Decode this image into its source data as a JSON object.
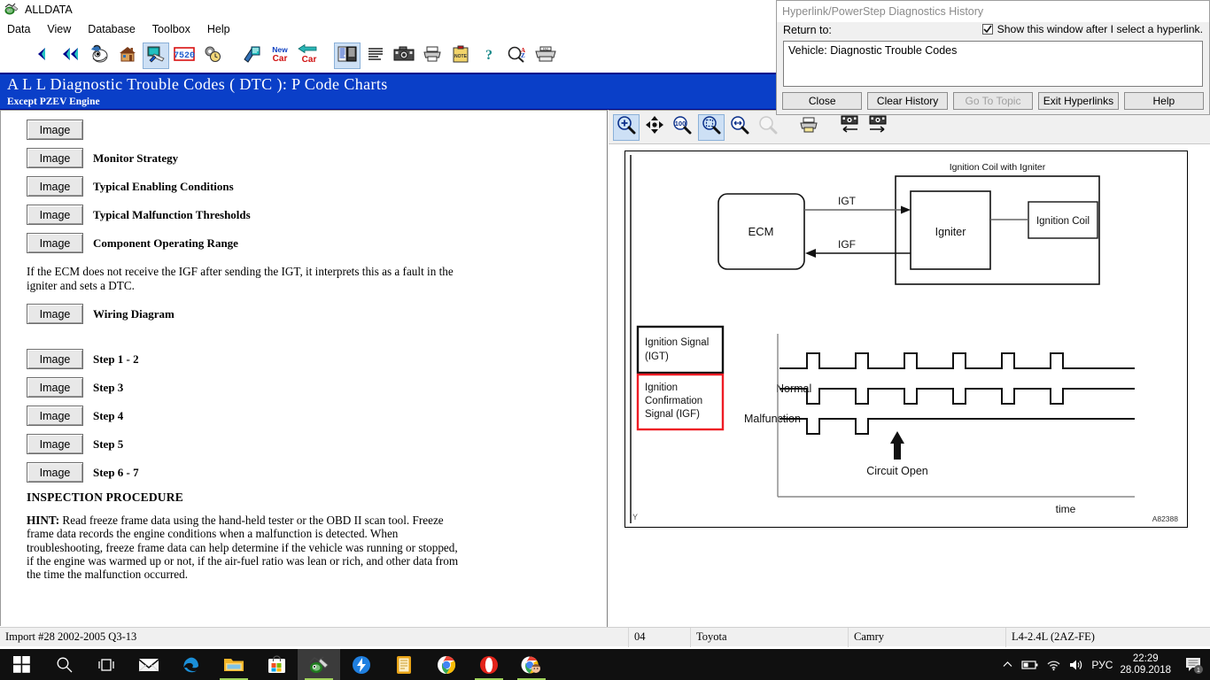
{
  "window": {
    "title": "ALLDATA",
    "app_icon": "alldata-icon"
  },
  "menu": {
    "items": [
      {
        "label": "Data"
      },
      {
        "label": "View"
      },
      {
        "label": "Database"
      },
      {
        "label": "Toolbox"
      },
      {
        "label": "Help"
      }
    ]
  },
  "toolbar": {
    "buttons": [
      {
        "name": "back-button",
        "icon": "left-triangle-icon",
        "selected": false
      },
      {
        "name": "back-fast-button",
        "icon": "double-left-triangle-icon",
        "selected": false
      },
      {
        "name": "mascot-button",
        "icon": "mascot-icon",
        "selected": false
      },
      {
        "name": "home-button",
        "icon": "house-icon",
        "selected": false
      },
      {
        "name": "repair-button",
        "icon": "monitor-tools-icon",
        "selected": true
      },
      {
        "name": "parts-button",
        "icon": "number-7520-icon",
        "selected": false
      },
      {
        "name": "labor-time-button",
        "icon": "gear-clock-icon",
        "selected": false
      },
      {
        "name": "estimator-button",
        "icon": "pencil-paper-icon",
        "selected": false
      },
      {
        "name": "new-car-button",
        "icon": "new-car-icon",
        "selected": false
      },
      {
        "name": "change-car-button",
        "icon": "change-car-icon",
        "selected": false
      },
      {
        "name": "article-list-button",
        "icon": "document-list-icon",
        "selected": true
      },
      {
        "name": "text-view-button",
        "icon": "text-lines-icon",
        "selected": false
      },
      {
        "name": "image-view-button",
        "icon": "camera-icon",
        "selected": false
      },
      {
        "name": "print-button",
        "icon": "printer-icon",
        "selected": false
      },
      {
        "name": "note-button",
        "icon": "note-clipboard-icon",
        "selected": false
      },
      {
        "name": "help-button",
        "icon": "question-mark-icon",
        "selected": false
      },
      {
        "name": "search-az-button",
        "icon": "magnifier-az-icon",
        "selected": false
      },
      {
        "name": "fax-button",
        "icon": "fax-icon",
        "selected": false
      }
    ]
  },
  "banner": {
    "title": "A L L  Diagnostic Trouble Codes ( DTC ):  P Code Charts",
    "subtitle": "Except PZEV Engine"
  },
  "document": {
    "image_button_label": "Image",
    "rows": [
      {
        "label": ""
      },
      {
        "label": "Monitor Strategy"
      },
      {
        "label": "Typical Enabling Conditions"
      },
      {
        "label": "Typical Malfunction Thresholds"
      },
      {
        "label": "Component Operating Range"
      }
    ],
    "paragraph": "If the ECM does not receive the IGF after sending the IGT, it interprets this as a fault in the igniter and sets a DTC.",
    "wiring_row": {
      "label": "Wiring Diagram"
    },
    "step_rows": [
      {
        "label": "Step 1 - 2"
      },
      {
        "label": "Step 3"
      },
      {
        "label": "Step 4"
      },
      {
        "label": "Step 5"
      },
      {
        "label": "Step 6 - 7"
      }
    ],
    "section_heading": "INSPECTION PROCEDURE",
    "hint_label": "HINT:",
    "hint_text": " Read freeze frame data using the hand-held tester or the OBD II scan tool. Freeze frame data records the engine conditions when a malfunction is detected. When troubleshooting, freeze frame data can help determine if the vehicle was running or stopped, if the engine was warmed up or not, if the air-fuel ratio was lean or rich, and other data from the time the malfunction occurred."
  },
  "viewer": {
    "buttons": [
      {
        "name": "zoom-in-button",
        "icon": "magnifier-plus-icon",
        "selected": true
      },
      {
        "name": "pan-button",
        "icon": "four-arrows-icon",
        "selected": false
      },
      {
        "name": "zoom-100-button",
        "icon": "magnifier-100-icon",
        "selected": false
      },
      {
        "name": "fit-page-button",
        "icon": "magnifier-fit-icon",
        "selected": true
      },
      {
        "name": "fit-width-button",
        "icon": "magnifier-width-icon",
        "selected": false
      },
      {
        "name": "tool-disabled-button",
        "icon": "magnifier-disabled-icon",
        "selected": false
      },
      {
        "name": "print-image-button",
        "icon": "printer-icon",
        "selected": false
      },
      {
        "name": "previous-image-button",
        "icon": "image-left-arrow-icon",
        "selected": false
      },
      {
        "name": "next-image-button",
        "icon": "image-right-arrow-icon",
        "selected": false
      }
    ]
  },
  "diagram": {
    "caption_ignition_coil_with_igniter": "Ignition Coil with Igniter",
    "ecm": "ECM",
    "igniter": "Igniter",
    "ignition_coil": "Ignition Coil",
    "igt_label": "IGT",
    "igf_label": "IGF",
    "legend_igt": "Ignition Signal (IGT)",
    "legend_igt_line1": "Ignition Signal",
    "legend_igt_line2": "(IGT)",
    "legend_igf_line1": "Ignition",
    "legend_igf_line2": "Confirmation",
    "legend_igf_line3": "Signal (IGF)",
    "normal_label": "Normal",
    "malfunction_label": "Malfunction",
    "circuit_open_label": "Circuit Open",
    "time_label": "time",
    "corner_mark": "Y",
    "figure_id": "A82388",
    "colors": {
      "highlight_box": "#ee1c25",
      "line": "#000000"
    }
  },
  "dialog": {
    "title": "Hyperlink/PowerStep Diagnostics History",
    "return_to_label": "Return to:",
    "checkbox_label": "Show this window after I select a hyperlink.",
    "checkbox_checked": true,
    "list_items": [
      "Vehicle:  Diagnostic Trouble Codes"
    ],
    "buttons": [
      {
        "label": "Close",
        "disabled": false,
        "name": "close-button"
      },
      {
        "label": "Clear History",
        "disabled": false,
        "name": "clear-history-button"
      },
      {
        "label": "Go To Topic",
        "disabled": true,
        "name": "go-to-topic-button"
      },
      {
        "label": "Exit Hyperlinks",
        "disabled": false,
        "name": "exit-hyperlinks-button"
      },
      {
        "label": "Help",
        "disabled": false,
        "name": "help-button"
      }
    ]
  },
  "statusbar": {
    "import": "Import #28 2002-2005 Q3-13",
    "year": "04",
    "make": "Toyota",
    "model": "Camry",
    "engine": "L4-2.4L (2AZ-FE)"
  },
  "taskbar": {
    "items": [
      {
        "name": "start-button",
        "icon": "windows-logo-icon",
        "active": false,
        "underline": false
      },
      {
        "name": "search-button",
        "icon": "search-icon",
        "active": false,
        "underline": false
      },
      {
        "name": "task-view-button",
        "icon": "task-view-icon",
        "active": false,
        "underline": false
      },
      {
        "name": "mail-button",
        "icon": "mail-icon",
        "active": false,
        "underline": false
      },
      {
        "name": "edge-button",
        "icon": "edge-icon",
        "active": false,
        "underline": false
      },
      {
        "name": "file-explorer-button",
        "icon": "folder-icon",
        "active": false,
        "underline": true
      },
      {
        "name": "store-button",
        "icon": "store-icon",
        "active": false,
        "underline": false
      },
      {
        "name": "alldata-button",
        "icon": "alldata-icon",
        "active": true,
        "underline": true
      },
      {
        "name": "download-manager-button",
        "icon": "lightning-icon",
        "active": false,
        "underline": false
      },
      {
        "name": "notes-button",
        "icon": "notepad-icon",
        "active": false,
        "underline": false
      },
      {
        "name": "chrome-button",
        "icon": "chrome-icon",
        "active": false,
        "underline": false
      },
      {
        "name": "opera-button",
        "icon": "opera-icon",
        "active": false,
        "underline": true
      },
      {
        "name": "chrome-profile-button",
        "icon": "chrome-profile-icon",
        "active": false,
        "underline": true
      }
    ],
    "tray": {
      "chevron": "show-hidden-icons",
      "battery": "battery-icon",
      "network": "wifi-icon",
      "volume": "speaker-icon",
      "language": "РУС",
      "time": "22:29",
      "date": "28.09.2018",
      "notifications_count": "1"
    }
  }
}
